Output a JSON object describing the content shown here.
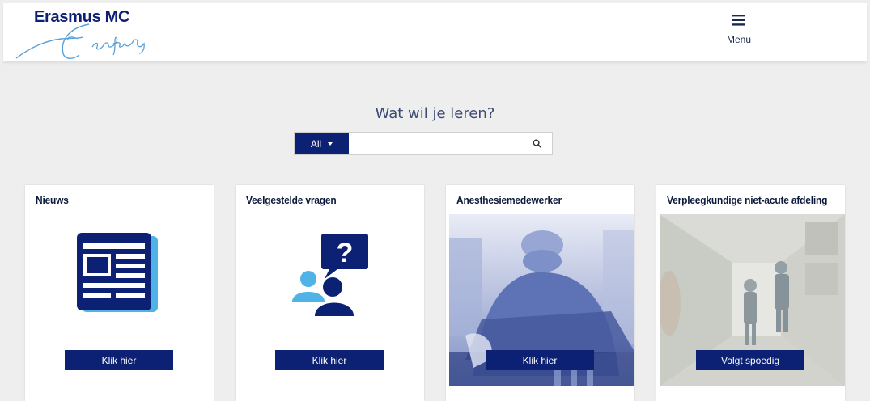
{
  "header": {
    "logo_text": "Erasmus MC",
    "menu_label": "Menu"
  },
  "search": {
    "title": "Wat wil je leren?",
    "filter_label": "All",
    "value": "",
    "placeholder": ""
  },
  "cards": [
    {
      "title": "Nieuws",
      "button": "Klik hier",
      "icon": "newspaper-icon"
    },
    {
      "title": "Veelgestelde vragen",
      "button": "Klik hier",
      "icon": "question-people-icon"
    },
    {
      "title": "Anesthesiemedewerker",
      "button": "Klik hier",
      "icon": "photo-operating-room"
    },
    {
      "title": "Verpleegkundige niet-acute afdeling",
      "button": "Volgt spoedig",
      "icon": "photo-hospital-corridor"
    }
  ],
  "colors": {
    "brand_navy": "#0c2074",
    "icon_blue": "#2a3f8f",
    "icon_light": "#4fb3e8",
    "page_bg": "#eeeeee"
  }
}
